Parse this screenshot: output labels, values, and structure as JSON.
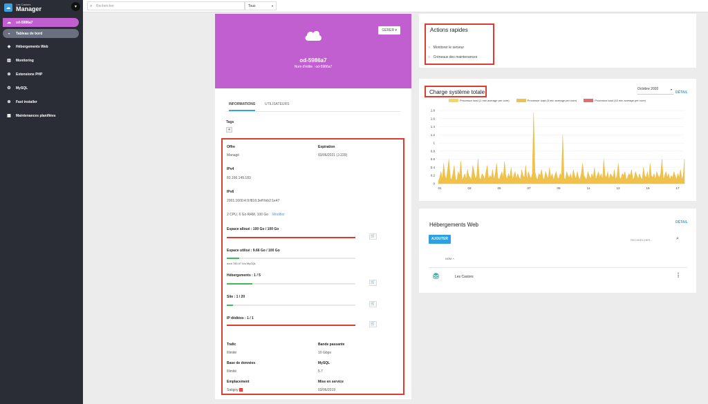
{
  "brand": {
    "sub": "Les Castors",
    "title": "Manager"
  },
  "sidebar": {
    "items": [
      {
        "label": "od-5986a7",
        "icon": "cloud-icon"
      },
      {
        "label": "Tableau de bord",
        "icon": "dashboard-icon"
      },
      {
        "label": "Hébergements Web",
        "icon": "layers-icon"
      },
      {
        "label": "Monitoring",
        "icon": "chart-icon"
      },
      {
        "label": "Extensions PHP",
        "icon": "plus-circle-icon"
      },
      {
        "label": "MySQL",
        "icon": "gear-icon"
      },
      {
        "label": "Fast installer",
        "icon": "plus-circle-icon"
      },
      {
        "label": "Maintenances planifiées",
        "icon": "calendar-icon"
      }
    ]
  },
  "topbar": {
    "search_placeholder": "Rechercher",
    "filter_value": "Tous"
  },
  "server": {
    "gerer_label": "GÉRER",
    "name": "od-5986a7",
    "nom_edite": "Nom d'édite : od-5986a7",
    "tabs": [
      "INFORMATIONS",
      "UTILISATEURS"
    ],
    "tags_label": "Tags",
    "tags_add": "+",
    "offre_label": "Offre",
    "offre_value": "Managé",
    "expiration_label": "Expiration",
    "expiration_value": "03/06/2021 (J-229)",
    "ipv4_label": "IPv4",
    "ipv4_value": "83.166.149.183",
    "ipv6_label": "IPv6",
    "ipv6_value": "2001:1600:4:9:f816:3eff:feb2:1e47",
    "specs": "2 CPU, 6 Go RAM, 100 Go",
    "modifier": "Modifier",
    "espace_alloue_label": "Espace alloué : 100 Go / 100 Go",
    "espace_alloue_ratio": 1.0,
    "espace_utilise_label": "Espace utilisé : 9.66 Go / 100 Go",
    "espace_utilise_ratio": 0.0966,
    "espace_utilise_note": "dont 785.97 Mo MySQL",
    "hebergements_label": "Hébergements : 1 / 5",
    "hebergements_ratio": 0.2,
    "site_label": "Site : 1 / 20",
    "site_ratio": 0.05,
    "ip_label": "IP dédiées : 1 / 1",
    "ip_ratio": 1.0,
    "trafic_label": "Trafic",
    "trafic_value": "Illimité",
    "bande_label": "Bande passante",
    "bande_value": "10 Gbps",
    "bdd_label": "Base de données",
    "bdd_value": "Illimité",
    "mysql_label": "MySQL",
    "mysql_value": "5.7",
    "emplacement_label": "Emplacement",
    "emplacement_value": "Satigny",
    "service_label": "Mise en service",
    "service_value": "03/06/2019",
    "cart_icon": "cart-icon",
    "colors": {
      "accent": "#c25fd0",
      "danger": "#e03a2e",
      "success": "#3cba54",
      "link": "#3aa0e0"
    }
  },
  "quick_actions": {
    "title": "Actions rapides",
    "items": [
      "Monitorer le serveur",
      "Créneaux des maintenances"
    ]
  },
  "load_chart": {
    "title": "Charge système totale",
    "month": "Octobre 2020",
    "detail": "DÉTAIL"
  },
  "chart_data": {
    "type": "area",
    "series": [
      {
        "name": "Processor load (1 min average per core)",
        "color": "#f6d860"
      },
      {
        "name": "Processor load (5 min average per core)",
        "color": "#f1c24b"
      },
      {
        "name": "Processor load (15 min average per core)",
        "color": "#e07070"
      }
    ],
    "x_ticks": [
      "01",
      "03",
      "05",
      "07",
      "09",
      "11",
      "13",
      "15",
      "17"
    ],
    "y_ticks": [
      "0",
      "0.2",
      "0.4",
      "0.6",
      "0.8",
      "1",
      "1.2",
      "1.4",
      "1.6",
      "1.8"
    ],
    "ylim": [
      0,
      1.8
    ],
    "values": [
      0.05,
      0.15,
      0.3,
      0.1,
      0.5,
      0.2,
      0.1,
      0.35,
      0.6,
      0.15,
      0.1,
      0.25,
      0.45,
      0.12,
      0.08,
      0.3,
      0.2,
      0.55,
      0.1,
      0.15,
      0.25,
      0.1,
      0.35,
      0.2,
      0.15,
      0.1,
      0.45,
      0.3,
      0.12,
      0.2,
      0.6,
      0.15,
      0.1,
      0.25,
      0.2,
      0.1,
      0.3,
      0.45,
      0.12,
      0.2,
      0.15,
      0.35,
      0.1,
      0.25,
      0.5,
      0.15,
      0.1,
      0.2,
      0.3,
      0.12,
      0.55,
      0.2,
      0.1,
      0.25,
      0.15,
      0.4,
      0.1,
      0.2,
      0.3,
      0.12,
      0.25,
      0.15,
      0.1,
      0.35,
      0.2,
      0.15,
      0.45,
      0.1,
      0.3,
      0.2,
      0.12,
      0.25,
      1.75,
      0.3,
      0.15,
      0.1,
      0.25,
      0.2,
      0.35,
      0.15,
      0.1,
      0.3,
      0.2,
      0.12,
      0.4,
      0.15,
      0.25,
      0.1,
      0.2,
      0.3,
      0.15,
      0.12,
      0.25,
      0.2,
      1.2,
      0.15,
      0.1,
      0.3,
      0.2,
      0.15,
      0.25,
      0.1,
      0.35,
      0.2,
      0.12,
      0.3,
      0.15,
      0.1,
      0.25,
      0.5,
      0.2,
      0.15,
      0.1,
      0.3,
      0.2,
      0.12,
      0.25,
      0.15,
      0.4,
      0.1,
      0.2,
      0.3,
      0.15,
      0.25,
      0.1,
      0.6,
      0.2,
      0.15,
      0.3,
      0.1,
      0.25,
      0.2,
      0.15,
      0.35,
      0.1,
      0.2,
      0.5,
      0.15,
      0.12,
      0.25,
      0.2,
      0.3,
      0.1,
      0.15,
      0.25,
      0.2,
      0.35,
      0.1,
      0.15,
      0.3,
      0.2,
      0.12,
      0.25,
      0.15,
      0.1,
      0.4,
      0.2,
      0.15,
      0.3,
      0.1,
      0.5,
      0.2,
      0.15,
      0.25,
      0.1,
      0.3,
      0.2,
      0.15,
      0.25,
      0.6,
      0.1,
      0.2,
      0.3,
      0.15,
      0.25,
      0.1,
      0.2,
      0.15,
      0.3,
      0.2,
      0.1,
      0.25,
      0.15,
      0.35,
      0.1,
      0.2,
      0.6
    ]
  },
  "web_hosting": {
    "title": "Hébergements Web",
    "detail": "DÉTAIL",
    "add_button": "AJOUTER",
    "search_placeholder": "RECHERCHER...",
    "col_nom": "NOM",
    "rows": [
      {
        "name": "Les Castors"
      }
    ]
  }
}
